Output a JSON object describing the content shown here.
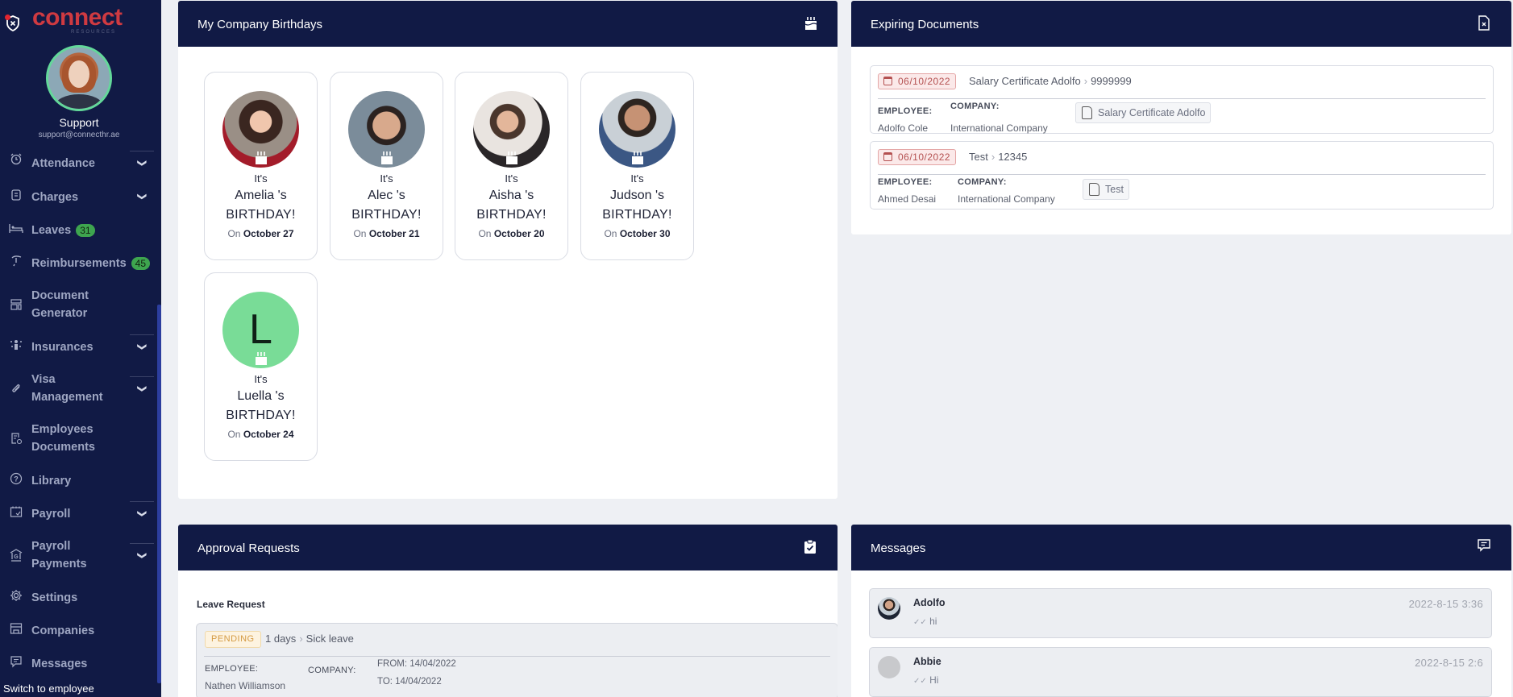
{
  "brand": {
    "name": "connect",
    "subtitle": "RESOURCES",
    "accent": "#cf3a41",
    "sidebar_bg": "#111a45"
  },
  "user": {
    "name": "Support",
    "email": "support@connecthr.ae"
  },
  "sidebar": {
    "items": [
      {
        "label": "Attendance",
        "icon": "alarm-clock-icon",
        "expandable": true
      },
      {
        "label": "Charges",
        "icon": "charges-icon",
        "expandable": true
      },
      {
        "label": "Leaves",
        "icon": "bed-icon",
        "badge": "31"
      },
      {
        "label": "Reimbursements",
        "icon": "reimbursement-icon",
        "badge": "45"
      },
      {
        "label": "Document",
        "label2": "Generator",
        "icon": "layout-icon"
      },
      {
        "label": "Insurances",
        "icon": "insurance-icon",
        "expandable": true
      },
      {
        "label": "Visa",
        "label2": "Management",
        "icon": "paperclip-icon",
        "expandable": true
      },
      {
        "label": "Employees",
        "label2": "Documents",
        "icon": "document-refresh-icon"
      },
      {
        "label": "Library",
        "icon": "help-circle-icon"
      },
      {
        "label": "Payroll",
        "icon": "calendar-check-icon",
        "expandable": true
      },
      {
        "label": "Payroll",
        "label2": "Payments",
        "icon": "bank-icon",
        "expandable": true
      },
      {
        "label": "Settings",
        "icon": "gear-icon"
      },
      {
        "label": "Companies",
        "icon": "store-icon"
      },
      {
        "label": "Messages",
        "icon": "message-icon"
      }
    ],
    "switch_label": "Switch to employee"
  },
  "birthdays": {
    "title": "My Company Birthdays",
    "its": "It's",
    "suffix": "'s",
    "birthday_word": "BIRTHDAY!",
    "on": "On",
    "people": [
      {
        "name": "Amelia",
        "date": "October 27"
      },
      {
        "name": "Alec",
        "date": "October 21"
      },
      {
        "name": "Aisha",
        "date": "October 20"
      },
      {
        "name": "Judson",
        "date": "October 30"
      },
      {
        "name": "Luella",
        "date": "October 24",
        "initial": "L"
      }
    ]
  },
  "expiring": {
    "title": "Expiring Documents",
    "employee_label": "EMPLOYEE:",
    "company_label": "COMPANY:",
    "docs": [
      {
        "date": "06/10/2022",
        "title": "Salary Certificate Adolfo",
        "number": "9999999",
        "employee": "Adolfo Cole",
        "company": "International Company",
        "file": "Salary Certificate Adolfo"
      },
      {
        "date": "06/10/2022",
        "title": "Test",
        "number": "12345",
        "employee": "Ahmed Desai",
        "company": "International Company",
        "file": "Test"
      }
    ]
  },
  "approvals": {
    "title": "Approval Requests",
    "section": "Leave Request",
    "requests": [
      {
        "status": "PENDING",
        "duration": "1 days",
        "type": "Sick leave",
        "employee_label": "EMPLOYEE:",
        "employee": "Nathen Williamson",
        "company_label": "COMPANY:",
        "from": "FROM: 14/04/2022",
        "to": "TO: 14/04/2022"
      }
    ]
  },
  "messages": {
    "title": "Messages",
    "items": [
      {
        "name": "Adolfo",
        "text": "hi",
        "time": "2022-8-15 3:36"
      },
      {
        "name": "Abbie",
        "text": "Hi",
        "time": "2022-8-15 2:6"
      }
    ]
  }
}
